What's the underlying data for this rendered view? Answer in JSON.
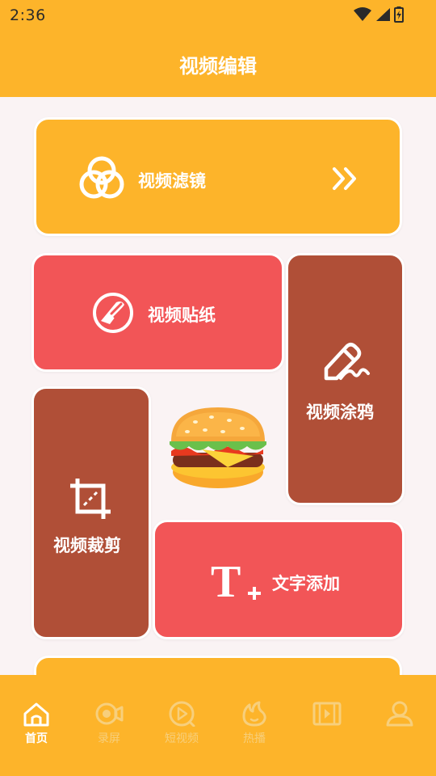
{
  "status_bar": {
    "time": "2:36"
  },
  "header": {
    "title": "视频编辑"
  },
  "cards": {
    "filter": {
      "label": "视频滤镜",
      "icon": "filter-circles-icon"
    },
    "sticker": {
      "label": "视频贴纸",
      "icon": "sticker-icon"
    },
    "doodle": {
      "label": "视频涂鸦",
      "icon": "pencil-icon"
    },
    "crop": {
      "label": "视频裁剪",
      "icon": "crop-icon"
    },
    "text": {
      "label": "文字添加",
      "icon": "text-add-icon"
    }
  },
  "bottom_nav": {
    "items": [
      {
        "label": "首页",
        "icon": "home-icon",
        "active": true
      },
      {
        "label": "录屏",
        "icon": "record-camera-icon",
        "active": false
      },
      {
        "label": "短视频",
        "icon": "play-circle-icon",
        "active": false
      },
      {
        "label": "热播",
        "icon": "flame-icon",
        "active": false
      },
      {
        "label": "",
        "icon": "film-icon",
        "active": false
      },
      {
        "label": "",
        "icon": "user-icon",
        "active": false
      }
    ]
  },
  "colors": {
    "primary": "#fdb42a",
    "red": "#f25557",
    "brown": "#b04f37",
    "background": "#faf3f4"
  }
}
